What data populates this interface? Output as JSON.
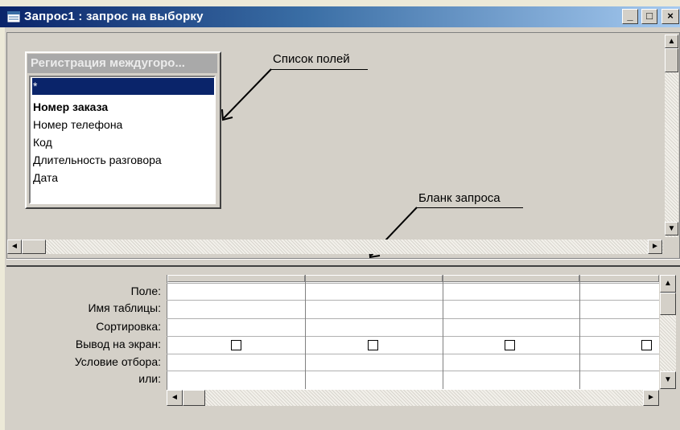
{
  "window": {
    "title": "Запрос1 : запрос на выборку",
    "minimize_label": "_",
    "maximize_label": "□",
    "close_label": "×"
  },
  "field_list": {
    "title": "Регистрация междугоро...",
    "items": [
      {
        "label": "*",
        "selected": true,
        "bold": false
      },
      {
        "label": "Номер заказа",
        "selected": false,
        "bold": true
      },
      {
        "label": "Номер телефона",
        "selected": false,
        "bold": false
      },
      {
        "label": "Код",
        "selected": false,
        "bold": false
      },
      {
        "label": "Длительность разговора",
        "selected": false,
        "bold": false
      },
      {
        "label": "Дата",
        "selected": false,
        "bold": false
      }
    ]
  },
  "annotations": {
    "field_list_label": "Список полей",
    "query_form_label": "Бланк запроса"
  },
  "query_grid": {
    "row_labels": [
      "Поле:",
      "Имя таблицы:",
      "Сортировка:",
      "Вывод на экран:",
      "Условие отбора:",
      "или:"
    ],
    "column_count": 4,
    "show_checkboxes": [
      false,
      false,
      false,
      false
    ]
  },
  "icons": {
    "window_icon": "query-icon",
    "scroll_up": "▲",
    "scroll_down": "▼",
    "scroll_left": "◄",
    "scroll_right": "►"
  },
  "colors": {
    "title_start": "#0a246a",
    "title_end": "#a6caf0",
    "selection": "#0a246a",
    "field_list_title": "#a9a9a9"
  }
}
